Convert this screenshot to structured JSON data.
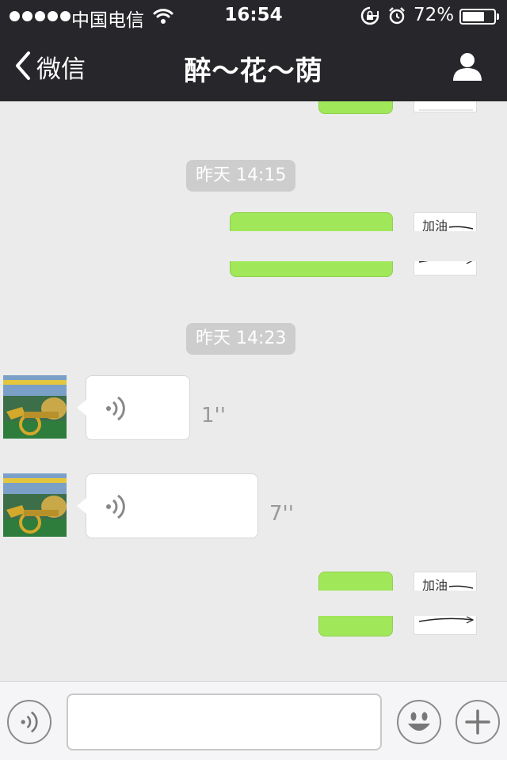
{
  "status_bar": {
    "carrier": "中国电信",
    "time": "16:54",
    "battery_percent_label": "72%",
    "battery_level": 0.72,
    "signal_dots": 5,
    "icons": [
      "wifi-icon",
      "rotation-lock-icon",
      "alarm-icon",
      "battery-icon"
    ]
  },
  "nav": {
    "back_label": "微信",
    "title": "醉～花～荫",
    "icons": [
      "chevron-left-icon",
      "person-icon"
    ]
  },
  "chat": {
    "timestamps": [
      "昨天 14:15",
      "昨天 14:23"
    ],
    "messages": [
      {
        "from": "self",
        "type": "text",
        "content": ""
      },
      {
        "from": "self",
        "type": "text",
        "content": ""
      },
      {
        "from": "other",
        "type": "voice",
        "duration": "1''"
      },
      {
        "from": "other",
        "type": "voice",
        "duration": "7''"
      },
      {
        "from": "self",
        "type": "text",
        "content": ""
      }
    ],
    "colors": {
      "self_bubble": "#a0e75a",
      "other_bubble": "#ffffff",
      "background": "#ebebeb"
    }
  },
  "input_bar": {
    "text_value": "",
    "icons": [
      "voice-toggle-icon",
      "emoji-icon",
      "plus-icon"
    ]
  }
}
